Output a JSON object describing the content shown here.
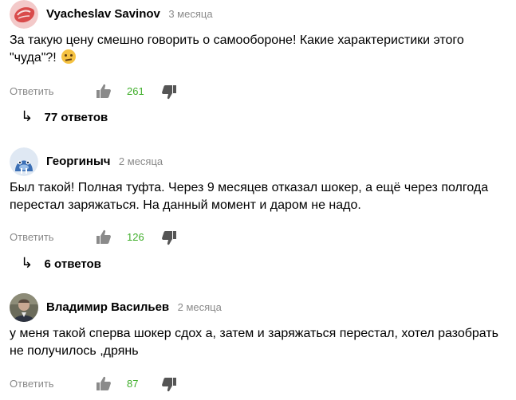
{
  "comments": [
    {
      "author": "Vyacheslav Savinov",
      "date": "3 месяца",
      "text": "За такую цену смешно говорить о самообороне! Какие характеристики этого \"чуда\"?!",
      "reply_label": "Ответить",
      "likes": "261",
      "replies_label": "77 ответов",
      "avatar": "red-meat-avatar",
      "emoji": "thinking-face-emoji"
    },
    {
      "author": "Георгиныч",
      "date": "2 месяца",
      "text": "Был такой! Полная туфта. Через 9 месяцев отказал шокер, а ещё через полгода перестал заряжаться. На данный момент и даром не надо.",
      "reply_label": "Ответить",
      "likes": "126",
      "replies_label": "6 ответов",
      "avatar": "walrus-avatar"
    },
    {
      "author": "Владимир Васильев",
      "date": "2 месяца",
      "text": "у меня такой сперва шокер сдох а, затем и заряжаться перестал, хотел разобрать не получилось ,дрянь",
      "reply_label": "Ответить",
      "likes": "87",
      "avatar": "photo-avatar"
    }
  ],
  "colors": {
    "like_count": "#3fae2a",
    "meta_gray": "#8a8a8a",
    "icon_gray": "#8a8a8a"
  }
}
